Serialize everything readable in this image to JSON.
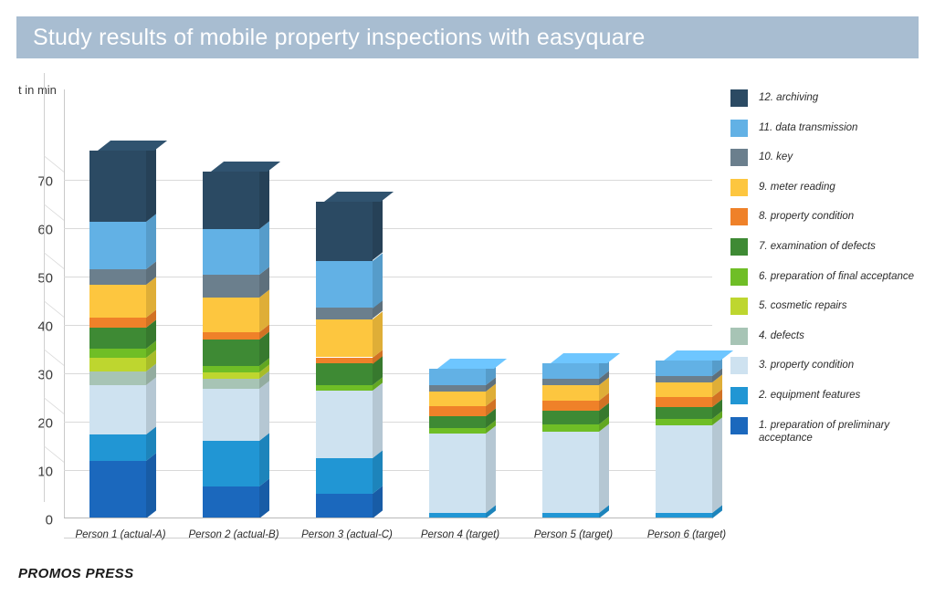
{
  "header": {
    "title": "Study results of mobile property inspections with easyquare",
    "band_color": "#a8bdd1"
  },
  "footer": {
    "text": "PROMOS PRESS"
  },
  "legend": {
    "position": "right",
    "items": [
      {
        "label": "12. archiving",
        "color": "#2b4a63"
      },
      {
        "label": "11. data transmission",
        "color": "#62b1e5"
      },
      {
        "label": "10. key",
        "color": "#6b7f8d"
      },
      {
        "label": "9. meter reading",
        "color": "#fdc63f"
      },
      {
        "label": "8. property condition",
        "color": "#ef8129"
      },
      {
        "label": "7. examination of defects",
        "color": "#3e8a34"
      },
      {
        "label": "6. preparation of final acceptance",
        "color": "#6fbe26"
      },
      {
        "label": "5. cosmetic repairs",
        "color": "#bed62f"
      },
      {
        "label": "4. defects",
        "color": "#a7c4b5"
      },
      {
        "label": "3. property condition",
        "color": "#cee2f0"
      },
      {
        "label": "2. equipment features",
        "color": "#2196d4"
      },
      {
        "label": "1. preparation of preliminary\nacceptance",
        "color": "#1b68bd"
      }
    ]
  },
  "chart_data": {
    "type": "bar",
    "subtype": "stacked-3d-column",
    "title": "Study results of mobile property inspections with easyquare",
    "xlabel": "",
    "ylabel": "t in min",
    "ylim": [
      0,
      75
    ],
    "yticks": [
      0,
      10,
      20,
      30,
      40,
      50,
      60,
      70
    ],
    "grid": true,
    "categories": [
      "Person 1 (actual-A)",
      "Person 2 (actual-B)",
      "Person 3 (actual-C)",
      "Person 4 (target)",
      "Person 5 (target)",
      "Person 6 (target)"
    ],
    "series": [
      {
        "name": "1. preparation of preliminary acceptance",
        "color": "#1b68bd",
        "values": [
          11.9,
          6.6,
          5.1,
          0,
          0,
          0
        ]
      },
      {
        "name": "2. equipment features",
        "color": "#2196d4",
        "values": [
          5.5,
          9.4,
          7.4,
          1.1,
          1.1,
          1.1
        ]
      },
      {
        "name": "3. property condition",
        "color": "#cee2f0",
        "values": [
          10.2,
          10.8,
          13.9,
          16.4,
          16.8,
          18.1
        ]
      },
      {
        "name": "4. defects",
        "color": "#a7c4b5",
        "values": [
          2.8,
          2.1,
          0,
          0,
          0,
          0
        ]
      },
      {
        "name": "5. cosmetic repairs",
        "color": "#bed62f",
        "values": [
          2.8,
          1.3,
          0,
          0,
          0,
          0
        ]
      },
      {
        "name": "6. preparation of final acceptance",
        "color": "#6fbe26",
        "values": [
          1.9,
          1.3,
          1.1,
          1.1,
          1.5,
          1.3
        ]
      },
      {
        "name": "7. examination of defects",
        "color": "#3e8a34",
        "values": [
          4.3,
          5.5,
          4.5,
          2.5,
          2.8,
          2.5
        ]
      },
      {
        "name": "8. property condition",
        "color": "#ef8129",
        "values": [
          2.1,
          1.5,
          1.3,
          2.1,
          2.1,
          2.1
        ]
      },
      {
        "name": "9. meter reading",
        "color": "#fdc63f",
        "values": [
          6.8,
          7.2,
          7.9,
          3.0,
          3.2,
          3.0
        ]
      },
      {
        "name": "10. key",
        "color": "#6b7f8d",
        "values": [
          3.2,
          4.7,
          2.3,
          1.3,
          1.3,
          1.3
        ]
      },
      {
        "name": "11. data transmission",
        "color": "#62b1e5",
        "values": [
          9.8,
          9.4,
          9.8,
          3.4,
          3.2,
          3.2
        ]
      },
      {
        "name": "12. archiving",
        "color": "#2b4a63",
        "values": [
          14.7,
          11.9,
          12.1,
          0,
          0,
          0
        ]
      }
    ],
    "totals": [
      76.0,
      71.7,
      65.4,
      30.9,
      32.0,
      32.6
    ]
  }
}
